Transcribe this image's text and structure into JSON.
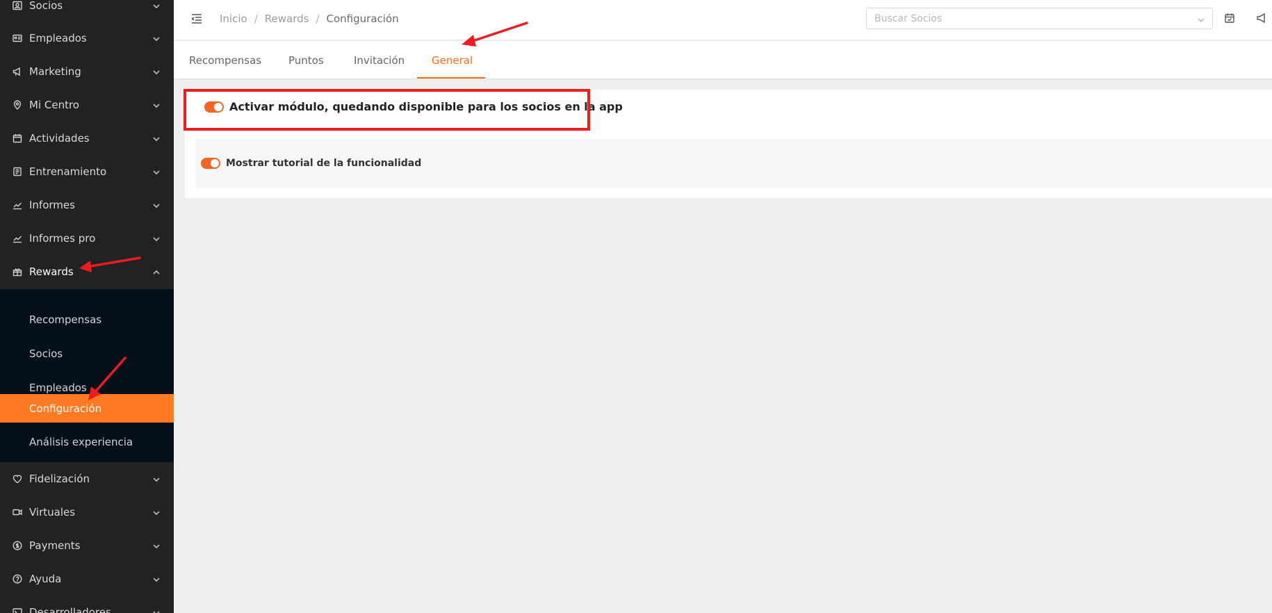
{
  "sidebar": {
    "items": [
      {
        "label": "Socios",
        "icon": "id-card-icon",
        "slug": "socios"
      },
      {
        "label": "Empleados",
        "icon": "badge-icon",
        "slug": "empleados"
      },
      {
        "label": "Marketing",
        "icon": "megaphone-icon",
        "slug": "marketing"
      },
      {
        "label": "Mi Centro",
        "icon": "location-pin-icon",
        "slug": "mi-centro"
      },
      {
        "label": "Actividades",
        "icon": "calendar-icon",
        "slug": "actividades"
      },
      {
        "label": "Entrenamiento",
        "icon": "clipboard-icon",
        "slug": "entrenamiento"
      },
      {
        "label": "Informes",
        "icon": "line-chart-icon",
        "slug": "informes"
      },
      {
        "label": "Informes pro",
        "icon": "line-chart-icon",
        "slug": "informes-pro"
      },
      {
        "label": "Rewards",
        "icon": "gift-icon",
        "slug": "rewards"
      }
    ],
    "rewards_submenu": [
      {
        "label": "Recompensas"
      },
      {
        "label": "Socios"
      },
      {
        "label": "Empleados"
      },
      {
        "label": "Configuración"
      },
      {
        "label": "Análisis experiencia"
      }
    ],
    "items_after": [
      {
        "label": "Fidelización",
        "icon": "heart-icon",
        "slug": "fidelizacion"
      },
      {
        "label": "Virtuales",
        "icon": "video-icon",
        "slug": "virtuales"
      },
      {
        "label": "Payments",
        "icon": "dollar-circle-icon",
        "slug": "payments"
      },
      {
        "label": "Ayuda",
        "icon": "help-circle-icon",
        "slug": "ayuda"
      },
      {
        "label": "Desarrolladores",
        "icon": "terminal-icon",
        "slug": "desarrolladores"
      }
    ]
  },
  "header": {
    "breadcrumb": [
      "Inicio",
      "Rewards",
      "Configuración"
    ],
    "breadcrumb_sep": "/",
    "search_placeholder": "Buscar Socios"
  },
  "tabs": [
    {
      "label": "Recompensas"
    },
    {
      "label": "Puntos"
    },
    {
      "label": "Invitación"
    },
    {
      "label": "General",
      "active": true
    }
  ],
  "settings": {
    "activate_module": {
      "label": "Activar módulo, quedando disponible para los socios en la app",
      "enabled": true
    },
    "show_tutorial": {
      "label": "Mostrar tutorial de la funcionalidad",
      "enabled": true
    }
  },
  "colors": {
    "accent": "#ff7a22",
    "sidebar_bg": "#222222",
    "submenu_bg": "#05101a",
    "annotation_red": "#ee1c1c"
  }
}
